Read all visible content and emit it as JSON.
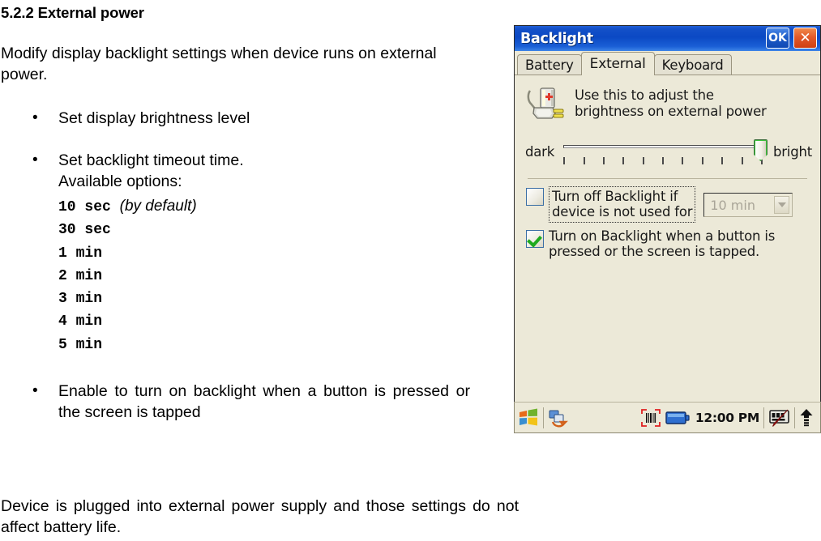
{
  "document": {
    "heading": "5.2.2 External power",
    "intro": "Modify display backlight settings when device runs on external power.",
    "bullets": [
      {
        "text": "Set display brightness level"
      },
      {
        "text": "Set backlight timeout time.",
        "sub": "Available options:"
      },
      {
        "text": "Enable to turn on backlight when a button is pressed or the screen is tapped"
      }
    ],
    "timeout_options": [
      {
        "value": "10 sec",
        "note": "(by default)"
      },
      {
        "value": "30 sec",
        "note": ""
      },
      {
        "value": "1 min",
        "note": ""
      },
      {
        "value": "2 min",
        "note": ""
      },
      {
        "value": "3 min",
        "note": ""
      },
      {
        "value": "4 min",
        "note": ""
      },
      {
        "value": "5 min",
        "note": ""
      }
    ],
    "closing": "Device is plugged into external power supply and those settings do not affect battery life."
  },
  "device": {
    "window": {
      "title": "Backlight",
      "ok_label": "OK",
      "close_label": "✕",
      "titlebar_color": "#0b49c4",
      "client_color": "#ece9d8"
    },
    "tabs": [
      {
        "label": "Battery",
        "active": false
      },
      {
        "label": "External",
        "active": true
      },
      {
        "label": "Keyboard",
        "active": false
      }
    ],
    "info": {
      "icon": "power-adapter-icon",
      "line1": "Use this to adjust the",
      "line2": "brightness on external power"
    },
    "slider": {
      "min_label": "dark",
      "max_label": "bright",
      "ticks": 11,
      "value_percent": 100,
      "accent_color": "#3bbf3b"
    },
    "options": {
      "turn_off": {
        "checked": false,
        "label_line1": "Turn off Backlight if",
        "label_line2": "device is not used for",
        "combo_value": "10 min",
        "combo_enabled": false
      },
      "turn_on": {
        "checked": true,
        "label_line1": "Turn on Backlight when a button is",
        "label_line2": "pressed or the screen is tapped."
      }
    },
    "taskbar": {
      "start_icon": "windows-start-icon",
      "app_icon": "sync-connection-icon",
      "scanner_icon": "barcode-scanner-icon",
      "battery_icon": "battery-icon",
      "clock": "12:00 PM",
      "input_panel_icon": "input-panel-icon",
      "arrow_icon": "up-arrow-icon"
    }
  }
}
